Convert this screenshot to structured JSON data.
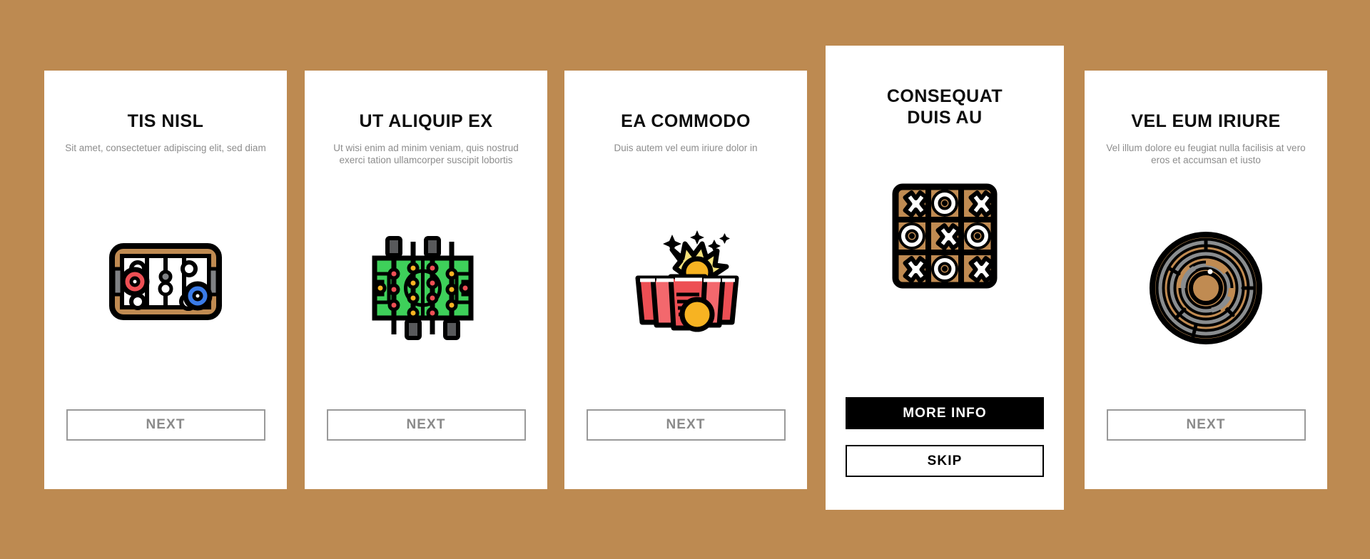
{
  "background_color": "#bd8a51",
  "cards": [
    {
      "id": "card-1",
      "title": "TIS NISL",
      "subtitle": "Sit amet, consectetuer adipiscing elit, sed diam",
      "icon": "air-hockey-table-icon",
      "featured": false,
      "buttons": [
        {
          "label": "NEXT",
          "style": "outline"
        }
      ]
    },
    {
      "id": "card-2",
      "title": "UT ALIQUIP EX",
      "subtitle": "Ut wisi enim ad minim veniam, quis nostrud exerci tation ullamcorper suscipit lobortis",
      "icon": "foosball-table-icon",
      "featured": false,
      "buttons": [
        {
          "label": "NEXT",
          "style": "outline"
        }
      ]
    },
    {
      "id": "card-3",
      "title": "EA COMMODO",
      "subtitle": "Duis autem vel eum iriure dolor in",
      "icon": "beer-pong-cups-icon",
      "featured": false,
      "buttons": [
        {
          "label": "NEXT",
          "style": "outline"
        }
      ]
    },
    {
      "id": "card-4",
      "title": "CONSEQUAT\nDUIS AU",
      "subtitle": "",
      "icon": "tic-tac-toe-board-icon",
      "featured": true,
      "buttons": [
        {
          "label": "MORE INFO",
          "style": "solid-black"
        },
        {
          "label": "SKIP",
          "style": "outline-black"
        }
      ]
    },
    {
      "id": "card-5",
      "title": "VEL EUM IRIURE",
      "subtitle": "Vel illum dolore eu feugiat nulla facilisis at vero eros et accumsan et iusto",
      "icon": "circular-maze-icon",
      "featured": false,
      "buttons": [
        {
          "label": "NEXT",
          "style": "outline"
        }
      ]
    }
  ],
  "icon_colors": {
    "outline": "#000000",
    "hockey_frame": "#c08b52",
    "hockey_puck_red": "#ed4f54",
    "hockey_puck_blue": "#3b7ce8",
    "hockey_slot_gray": "#808285",
    "foosball_field": "#3ed05a",
    "foosball_rod_gray": "#58595b",
    "foosball_player_red": "#ed4f54",
    "foosball_player_yellow": "#f7b322",
    "cup_red": "#ed4f54",
    "cup_red_light": "#f3686d",
    "ball_yellow": "#f7b322",
    "splash_yellow": "#f6e27a",
    "board_brown": "#c08b52",
    "maze_brown": "#c08b52",
    "maze_gray": "#8a8d8f",
    "white": "#ffffff"
  }
}
